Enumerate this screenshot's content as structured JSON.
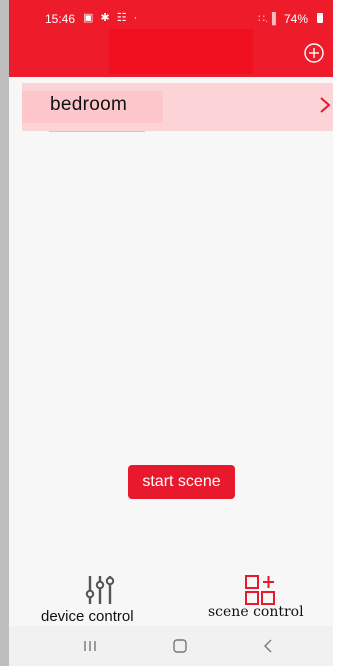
{
  "status_bar": {
    "time": "15:46",
    "left_icons": "▣ ✱ ☷ ·",
    "signal": "∷.▐",
    "battery": "74%"
  },
  "colors": {
    "header": "#ee1c2b",
    "row_background": "#fcd3d6",
    "button": "#e8192c"
  },
  "header": {
    "add_icon": "plus-circle-icon"
  },
  "rooms": [
    {
      "name": "bedroom",
      "icon": "chevron-right-icon"
    }
  ],
  "actions": {
    "start_scene_label": "start scene"
  },
  "bottom_nav": {
    "items": [
      {
        "label": "device control",
        "icon": "sliders-icon"
      },
      {
        "label": "scene control",
        "icon": "scene-add-icon"
      }
    ]
  },
  "system_nav": {
    "recents_icon": "recents-icon",
    "home_icon": "home-icon",
    "back_icon": "back-icon"
  }
}
